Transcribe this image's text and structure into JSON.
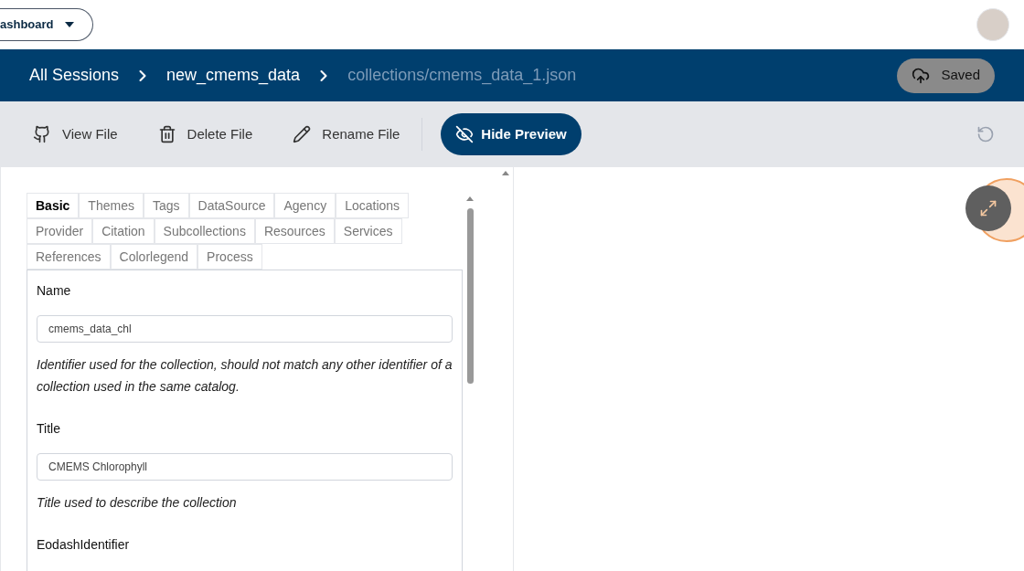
{
  "top_bar": {
    "dashboard_button": "ashboard"
  },
  "breadcrumb": [
    {
      "label": "All Sessions",
      "current": false
    },
    {
      "label": "new_cmems_data",
      "current": false
    },
    {
      "label": "collections/cmems_data_1.json",
      "current": true
    }
  ],
  "save_status": "Saved",
  "toolbar": [
    {
      "kind": "github",
      "label": "View File"
    },
    {
      "kind": "delete",
      "label": "Delete File"
    },
    {
      "kind": "rename",
      "label": "Rename File"
    }
  ],
  "preview_button": "Hide Preview",
  "tab_rows": [
    [
      {
        "label": "Basic",
        "selected": true
      },
      {
        "label": "Themes",
        "selected": false
      },
      {
        "label": "Tags",
        "selected": false
      },
      {
        "label": "DataSource",
        "selected": false
      },
      {
        "label": "Agency",
        "selected": false
      },
      {
        "label": "Locations",
        "selected": false
      }
    ],
    [
      {
        "label": "Provider",
        "selected": false
      },
      {
        "label": "Citation",
        "selected": false
      },
      {
        "label": "Subcollections",
        "selected": false
      },
      {
        "label": "Resources",
        "selected": false
      },
      {
        "label": "Services",
        "selected": false
      }
    ],
    [
      {
        "label": "References",
        "selected": false
      },
      {
        "label": "Colorlegend",
        "selected": false
      },
      {
        "label": "Process",
        "selected": false
      }
    ]
  ],
  "fields": [
    {
      "label": "Name",
      "value": "cmems_data_chl",
      "help": "Identifier used for the collection, should not match any other identifier of a collection used in the same catalog."
    },
    {
      "label": "Title",
      "value": "CMEMS Chlorophyll",
      "help": "Title used to describe the collection"
    },
    {
      "label": "EodashIdentifier"
    }
  ]
}
